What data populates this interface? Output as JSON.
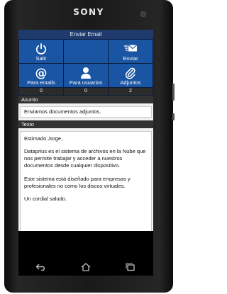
{
  "device": {
    "brand": "SONY"
  },
  "screen": {
    "title": "Enviar Email",
    "tiles": [
      {
        "label": "Salir",
        "icon": "power-icon"
      },
      {
        "label": "",
        "icon": ""
      },
      {
        "label": "Enviar",
        "icon": "send-mail-icon"
      },
      {
        "label": "Para emails",
        "icon": "at-sign-icon"
      },
      {
        "label": "Para usuarios",
        "icon": "user-icon"
      },
      {
        "label": "Adjuntos",
        "icon": "paperclip-icon"
      }
    ],
    "counts": [
      "0",
      "0",
      "2"
    ],
    "subject": {
      "header": "Asunto",
      "value": "Enviamos documentos adjuntos."
    },
    "body": {
      "header": "Texto",
      "paragraphs": [
        "Estimado Jorge,",
        "Dataprius es el sistema de archivos en la Nube que nos permite trabajar y acceder a nuestros documentos desde cualquier dispositivo.",
        "Este sistema está diseñado para empresas y profesionales no como los discos virtuales.",
        "Un cordial saludo."
      ]
    }
  },
  "colors": {
    "tile": "#1a55a3",
    "titlebar": "#1f3b6e",
    "section_header": "#333333"
  },
  "navbar": {
    "icons": [
      "back-icon",
      "home-icon",
      "recent-apps-icon"
    ]
  }
}
